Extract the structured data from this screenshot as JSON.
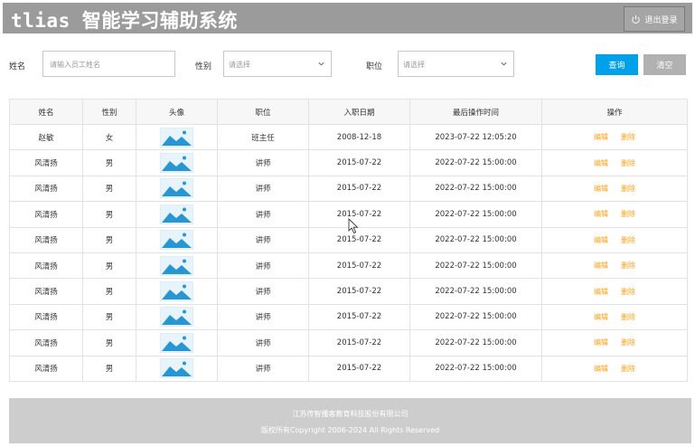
{
  "header": {
    "title": "tlias 智能学习辅助系统",
    "logout_label": "退出登录",
    "logout_icon": "power-icon"
  },
  "search": {
    "name_label": "姓名",
    "name_placeholder": "请输入员工姓名",
    "name_value": "",
    "gender_label": "性别",
    "gender_placeholder": "请选择",
    "position_label": "职位",
    "position_placeholder": "请选择",
    "query_label": "查询",
    "clear_label": "清空"
  },
  "table": {
    "headers": [
      "姓名",
      "性别",
      "头像",
      "职位",
      "入职日期",
      "最后操作时间",
      "操作"
    ],
    "edit_label": "编辑",
    "delete_label": "删除",
    "rows": [
      {
        "name": "赵敏",
        "gender": "女",
        "position": "班主任",
        "entry_date": "2008-12-18",
        "updated": "2023-07-22 12:05:20"
      },
      {
        "name": "风清扬",
        "gender": "男",
        "position": "讲师",
        "entry_date": "2015-07-22",
        "updated": "2022-07-22 15:00:00"
      },
      {
        "name": "风清扬",
        "gender": "男",
        "position": "讲师",
        "entry_date": "2015-07-22",
        "updated": "2022-07-22 15:00:00"
      },
      {
        "name": "风清扬",
        "gender": "男",
        "position": "讲师",
        "entry_date": "2015-07-22",
        "updated": "2022-07-22 15:00:00"
      },
      {
        "name": "风清扬",
        "gender": "男",
        "position": "讲师",
        "entry_date": "2015-07-22",
        "updated": "2022-07-22 15:00:00"
      },
      {
        "name": "风清扬",
        "gender": "男",
        "position": "讲师",
        "entry_date": "2015-07-22",
        "updated": "2022-07-22 15:00:00"
      },
      {
        "name": "风清扬",
        "gender": "男",
        "position": "讲师",
        "entry_date": "2015-07-22",
        "updated": "2022-07-22 15:00:00"
      },
      {
        "name": "风清扬",
        "gender": "男",
        "position": "讲师",
        "entry_date": "2015-07-22",
        "updated": "2022-07-22 15:00:00"
      },
      {
        "name": "风清扬",
        "gender": "男",
        "position": "讲师",
        "entry_date": "2015-07-22",
        "updated": "2022-07-22 15:00:00"
      },
      {
        "name": "风清扬",
        "gender": "男",
        "position": "讲师",
        "entry_date": "2015-07-22",
        "updated": "2022-07-22 15:00:00"
      }
    ]
  },
  "footer": {
    "company": "江苏传智播客教育科技股份有限公司",
    "copyright": "版权所有Copyright 2006-2024 All Rights Reserved"
  },
  "colors": {
    "header_bg": "#9b9b9b",
    "query_button": "#00a1ea",
    "clear_button": "#b1b1b1",
    "action_link": "#f5a21a",
    "footer_bg": "#cdcdcd"
  }
}
